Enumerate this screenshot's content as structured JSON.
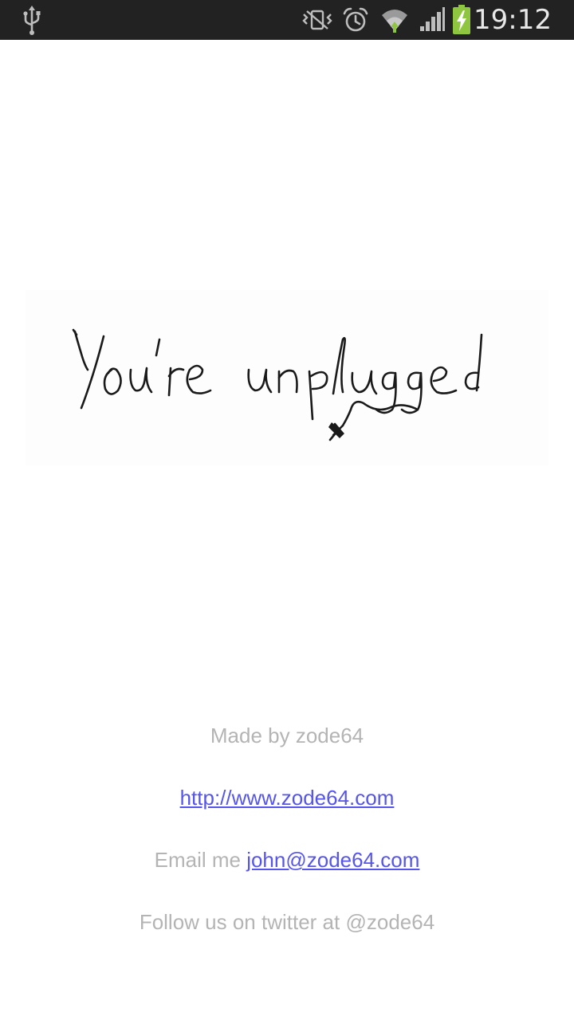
{
  "status_bar": {
    "time": "19:12",
    "icons": [
      "usb-icon",
      "vibrate-icon",
      "alarm-icon",
      "wifi-icon",
      "signal-icon",
      "battery-charging-icon"
    ],
    "battery_color": "#8ec63f"
  },
  "banner": {
    "handwritten_text": "You're unplugged",
    "graphic": "unplugged-cable-drawing"
  },
  "footer": {
    "made_by": "Made by zode64",
    "website_link": "http://www.zode64.com",
    "email_prefix": "Email me ",
    "email_link": "john@zode64.com",
    "twitter": "Follow us on twitter at @zode64"
  },
  "colors": {
    "link": "#5555ee",
    "muted_text": "#b4b4b4",
    "status_bar_bg": "#222222"
  }
}
